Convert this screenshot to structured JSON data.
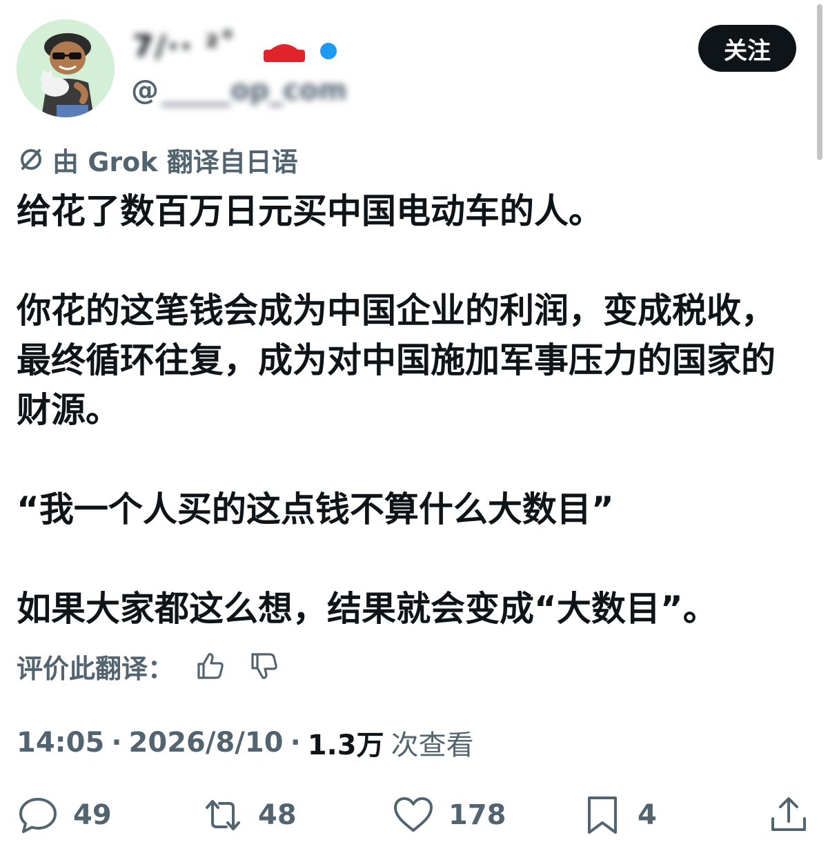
{
  "author": {
    "display_name": "7∕·· ²˚",
    "handle_prefix": "@",
    "handle_rest": "_____op_com",
    "follow_label": "关注"
  },
  "translation": {
    "note": "由 Grok 翻译自日语",
    "rate_label": "评价此翻译："
  },
  "tweet": {
    "paragraphs": [
      "给花了数百万日元买中国电动车的人。",
      "你花的这笔钱会成为中国企业的利润，变成税收，最终循环往复，成为对中国施加军事压力的国家的财源。",
      "“我一个人买的这点钱不算什么大数目”",
      "如果大家都这么想，结果就会变成“大数目”。"
    ]
  },
  "meta": {
    "time": "14:05",
    "date": "2026/8/10",
    "separator": "·",
    "views_count": "1.3万",
    "views_label": "次查看"
  },
  "actions": {
    "replies": "49",
    "reposts": "48",
    "likes": "178",
    "bookmarks": "4"
  },
  "colors": {
    "text_primary": "#0f1419",
    "text_secondary": "#536471",
    "avatar_bg": "#d3f0d6",
    "follow_bg": "#0f1419",
    "badge_red": "#e0242b",
    "badge_blue": "#1d9bf0"
  },
  "icons": {
    "translate": "grok-slash-icon",
    "thumbs_up": "thumbs-up-icon",
    "thumbs_down": "thumbs-down-icon",
    "reply": "reply-bubble-icon",
    "repost": "repost-arrows-icon",
    "like": "heart-icon",
    "bookmark": "bookmark-icon",
    "share": "share-upload-icon"
  }
}
